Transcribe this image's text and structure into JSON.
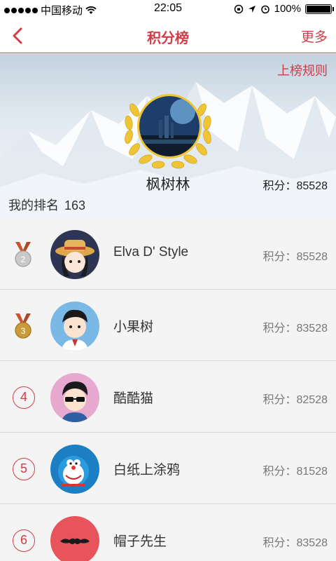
{
  "status_bar": {
    "carrier": "中国移动",
    "time": "22:05",
    "battery": "100%",
    "battery_level": 1.0
  },
  "nav": {
    "back_icon": "chevron-left-icon",
    "title": "积分榜",
    "more": "更多"
  },
  "hero": {
    "rules_link": "上榜规则",
    "me_name": "枫树林",
    "me_score": "积分：85528",
    "rank_label": "我的排名",
    "rank_value": "163"
  },
  "colors": {
    "accent": "#d23c46",
    "gold": "#f0c534",
    "silver_badge": "#c9c9c9",
    "bronze_badge": "#c89a3a"
  },
  "ranking": [
    {
      "rank": "2",
      "badge": "silver-medal-icon",
      "name": "Elva D' Style",
      "score": "积分：85528"
    },
    {
      "rank": "3",
      "badge": "bronze-medal-icon",
      "name": "小果树",
      "score": "积分：83528"
    },
    {
      "rank": "4",
      "badge": "circle",
      "name": "酷酷猫",
      "score": "积分：82528"
    },
    {
      "rank": "5",
      "badge": "circle",
      "name": "白纸上涂鸦",
      "score": "积分：81528"
    },
    {
      "rank": "6",
      "badge": "circle",
      "name": "帽子先生",
      "score": "积分：83528"
    }
  ]
}
